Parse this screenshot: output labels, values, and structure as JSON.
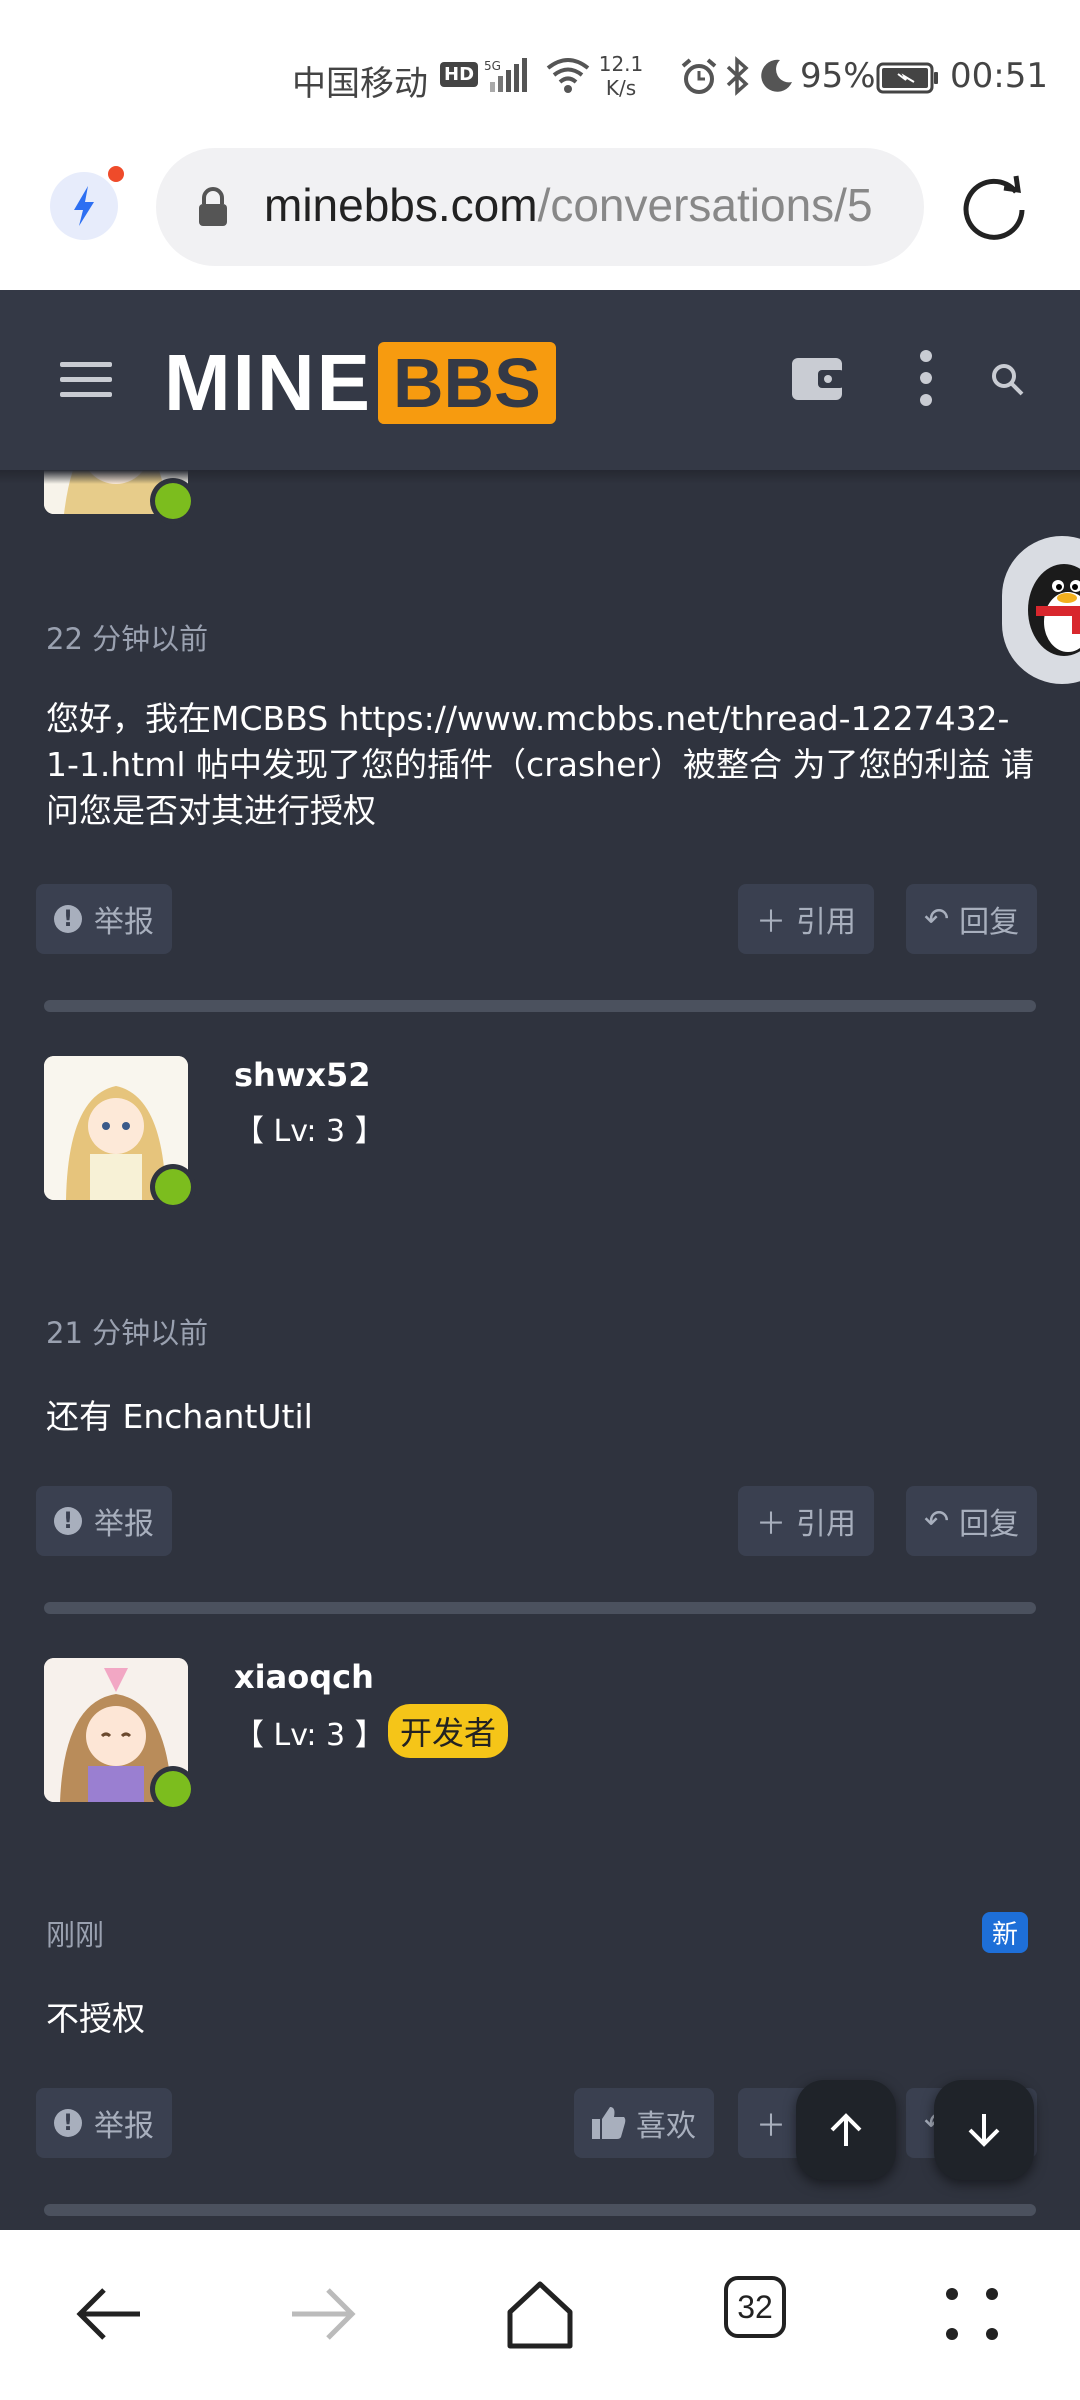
{
  "status_bar": {
    "carrier": "中国移动",
    "hd": "HD",
    "network": "5G",
    "speed_value": "12.1",
    "speed_unit": "K/s",
    "battery_pct": "95%",
    "time": "00:51"
  },
  "browser": {
    "url_domain": "minebbs.com",
    "url_path": "/conversations/5",
    "tabs_count": "32"
  },
  "site": {
    "logo_mine": "MINE",
    "logo_bbs": "BBS"
  },
  "messages": [
    {
      "time": "22 分钟以前",
      "text": "您好，我在MCBBS https://www.mcbbs.net/thread-1227432-1-1.html 帖中发现了您的插件（crasher）被整合 为了您的利益 请问您是否对其进行授权"
    },
    {
      "username": "shwx52",
      "level": "【 Lv: 3 】",
      "time": "21 分钟以前",
      "text": "还有 EnchantUtil"
    },
    {
      "username": "xiaoqch",
      "level": "【 Lv: 3 】",
      "badge": "开发者",
      "time": "刚刚",
      "new_label": "新",
      "text": "不授权"
    }
  ],
  "actions": {
    "report": "举报",
    "quote": "引用",
    "reply": "回复",
    "like": "喜欢"
  },
  "colors": {
    "header_bg": "#343946",
    "content_bg": "#2f333e",
    "accent": "#f79b0f",
    "online": "#7cbd1e",
    "dev_badge": "#f5c518",
    "new_badge": "#1e6fd8"
  }
}
